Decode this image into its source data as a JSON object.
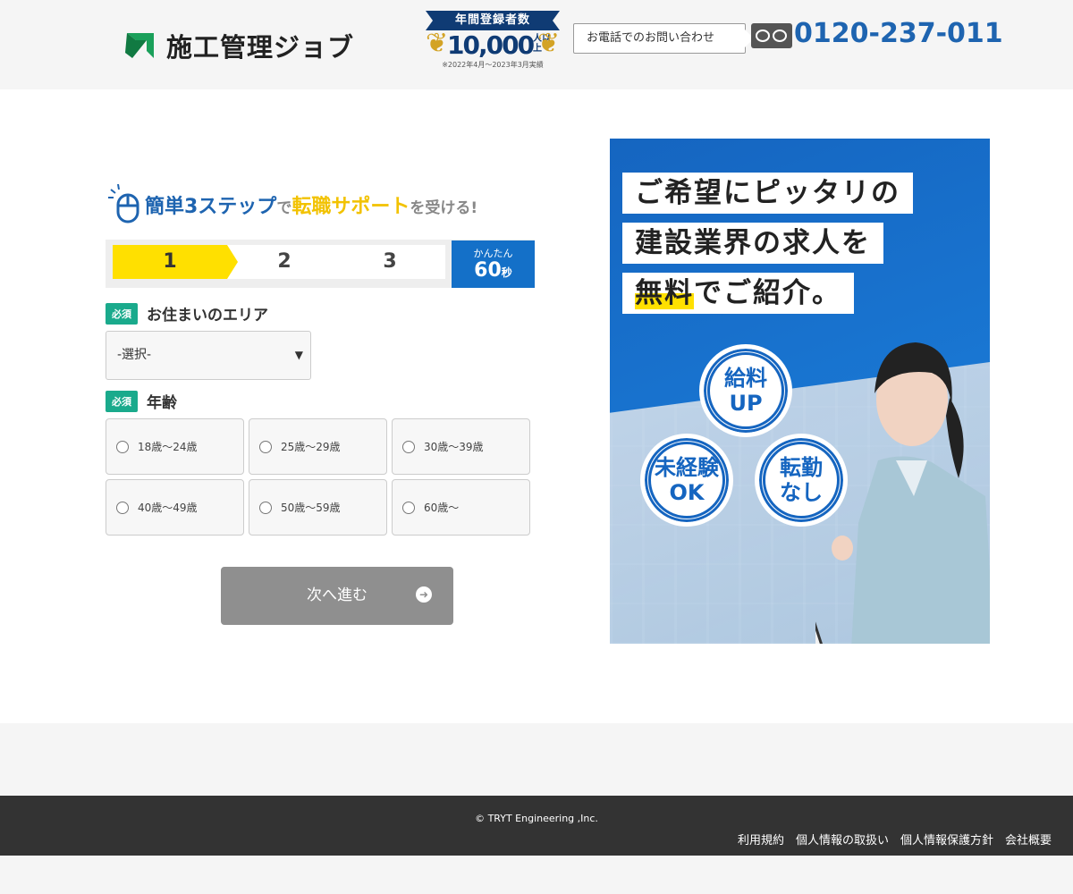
{
  "header": {
    "logo_text": "施工管理ジョブ",
    "badge": {
      "ribbon": "年間登録者数",
      "count": "10,000",
      "unit": "人以上",
      "note": "※2022年4月～2023年3月実績"
    },
    "contact_label": "お電話でのお問い合わせ",
    "phone": "0120-237-011"
  },
  "form": {
    "title": {
      "part1": "簡単3ステップ",
      "part2": "で",
      "part3": "転職サポート",
      "part4": "を受ける!"
    },
    "steps": [
      "1",
      "2",
      "3"
    ],
    "current_step": 1,
    "time_label": "かんたん",
    "time_value": "60",
    "time_unit": "秒",
    "required_tag": "必須",
    "area_label": "お住まいのエリア",
    "area_select_value": "-選択-",
    "age_label": "年齢",
    "age_options": [
      "18歳～24歳",
      "25歳～29歳",
      "30歳～39歳",
      "40歳～49歳",
      "50歳～59歳",
      "60歳～"
    ],
    "next_label": "次へ進む"
  },
  "promo": {
    "line1": "ご希望にピッタリの",
    "line2": "建設業界の求人を",
    "line3_hl": "無料",
    "line3_rest": "でご紹介。",
    "circles": [
      {
        "l1": "給料",
        "l2": "UP"
      },
      {
        "l1": "未経験",
        "l2": "OK"
      },
      {
        "l1": "転勤",
        "l2": "なし"
      }
    ]
  },
  "footer": {
    "copyright": "© TRYT Engineering ,Inc.",
    "links": [
      "利用規約",
      "個人情報の取扱い",
      "個人情報保護方針",
      "会社概要"
    ]
  },
  "colors": {
    "brand_blue": "#1e64b0",
    "accent_yellow": "#ffe000",
    "required_green": "#1aaa8c",
    "button_gray": "#8f8f8f"
  }
}
